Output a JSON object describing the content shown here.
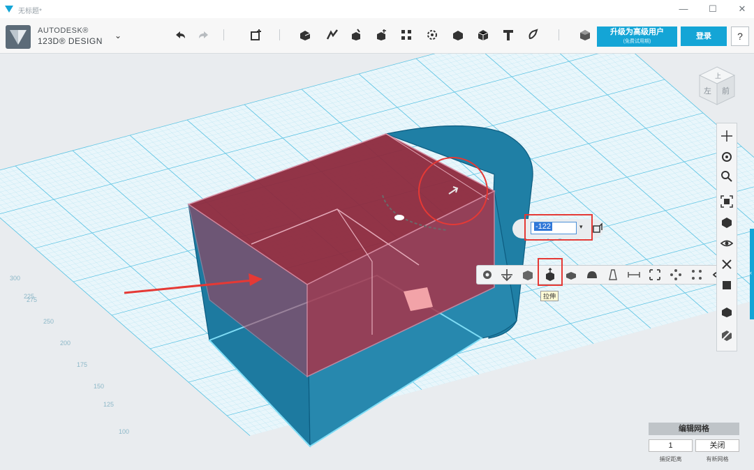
{
  "titlebar": {
    "title": "无标题*"
  },
  "window_controls": {
    "minimize": "—",
    "maximize": "☐",
    "close": "✕"
  },
  "brand": {
    "line1": "AUTODESK®",
    "line2": "123D® DESIGN"
  },
  "toolbar": {
    "tools": [
      "undo-icon",
      "redo-icon",
      "primitives-icon",
      "sketch-icon",
      "construct-icon",
      "modify-icon",
      "pattern-icon",
      "group-icon",
      "combine-icon",
      "measure-icon",
      "text-icon",
      "snap-icon",
      "material-icon"
    ]
  },
  "header_buttons": {
    "upgrade_label": "升级为高级用户",
    "upgrade_sub": "(免费试用期)",
    "login_label": "登录",
    "help_label": "?"
  },
  "viewcube": {
    "top": "上",
    "left": "左",
    "front": "前"
  },
  "grid_labels": [
    "300",
    "275",
    "250",
    "225",
    "200",
    "175",
    "150",
    "125",
    "100"
  ],
  "value_input": {
    "value": "-122"
  },
  "context_tooltip": "拉伸",
  "mesh_panel": {
    "title": "编辑网格",
    "snap_value": "1",
    "close_label": "关闭",
    "snap_caption": "捕捉距离",
    "grid_caption": "有新网格"
  },
  "colors": {
    "accent": "#14a5d6",
    "grid": "#7fd2ea",
    "body": "#1f7fa5",
    "selected_face": "#a8344a",
    "highlight": "#e53935"
  }
}
